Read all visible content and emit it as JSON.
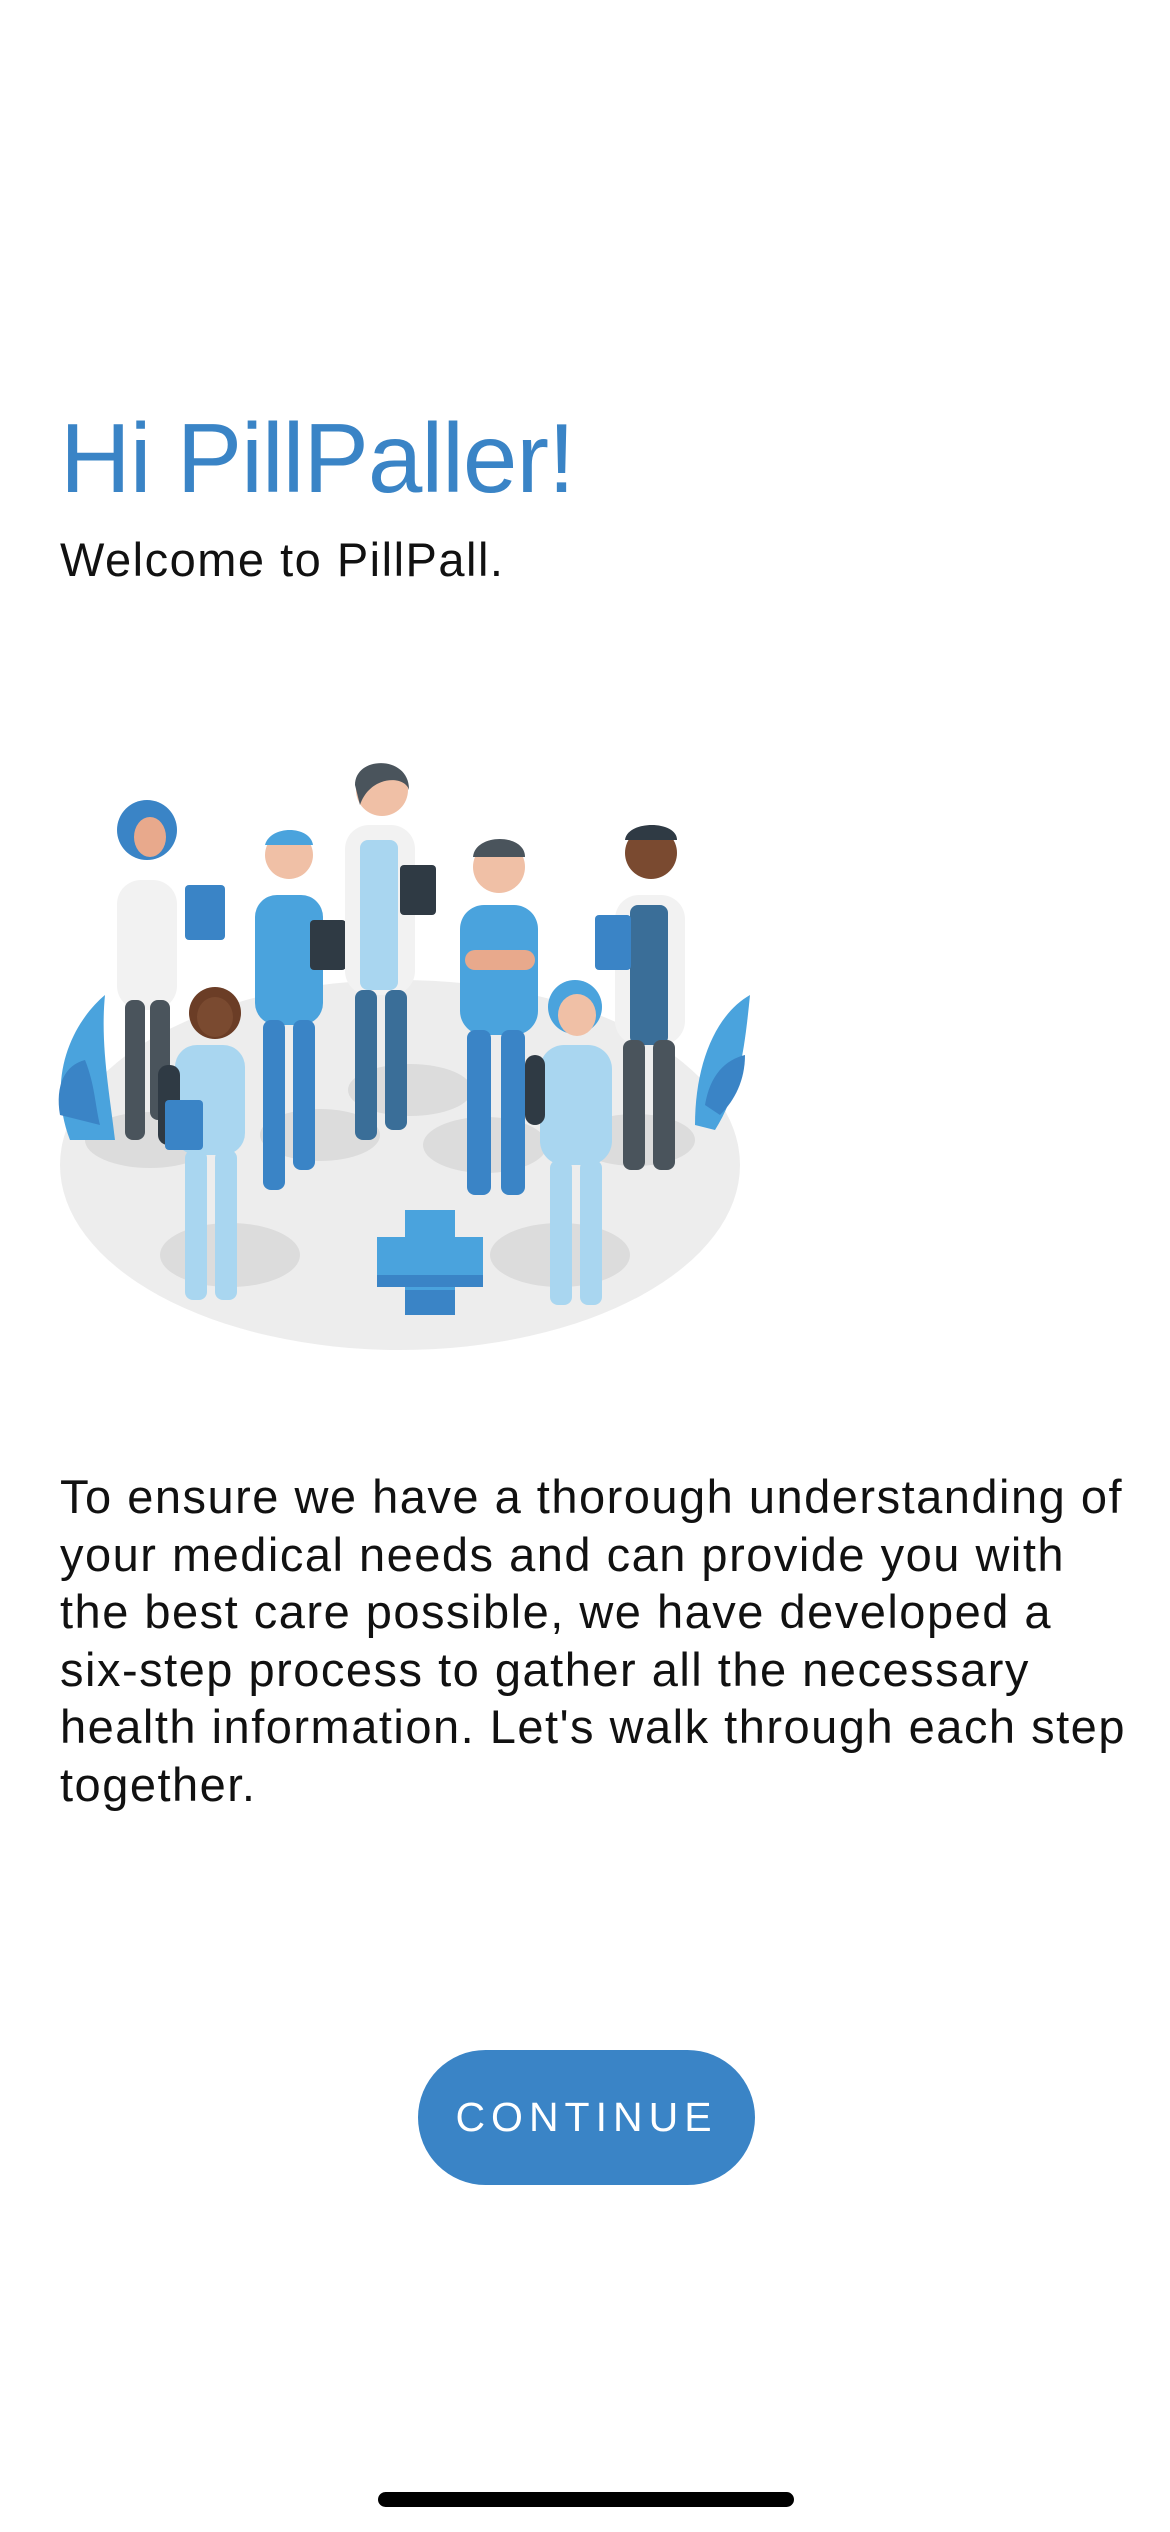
{
  "welcome": {
    "heading": "Hi PillPaller!",
    "subheading": "Welcome to PillPall.",
    "illustration_icon": "medical-team-illustration",
    "description": "To ensure we have a thorough understanding of your medical needs and can provide you with the best care possible, we have developed a six-step process to gather all the necessary health information. Let's walk through each step together."
  },
  "actions": {
    "continue_label": "CONTINUE"
  },
  "colors": {
    "accent": "#3a84c6",
    "button": "#3a84c6",
    "text": "#111111",
    "background": "#ffffff"
  }
}
